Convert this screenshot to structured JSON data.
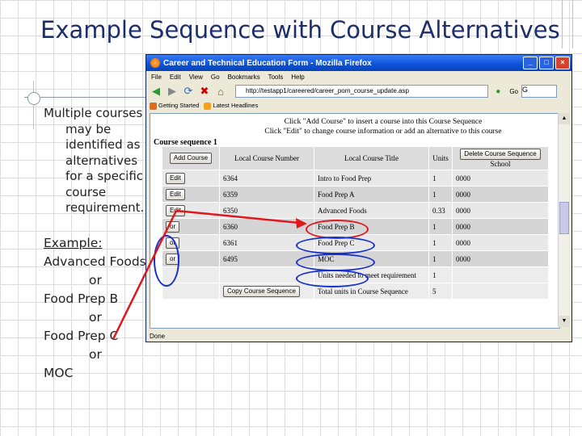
{
  "slide": {
    "title": "Example Sequence with Course Alternatives",
    "bullet_lines": [
      "Multiple courses",
      "may be",
      "identified as",
      "alternatives",
      "for a specific",
      "course",
      "requirement."
    ],
    "example_label": "Example:",
    "example_lines": [
      "Advanced Foods",
      "or",
      "Food Prep B",
      "or",
      "Food Prep C",
      "or",
      "MOC"
    ]
  },
  "browser": {
    "title": "Career and Technical Education Form - Mozilla Firefox",
    "menu": [
      "File",
      "Edit",
      "View",
      "Go",
      "Bookmarks",
      "Tools",
      "Help"
    ],
    "url": "http://testapp1/careered/career_pom_course_update.asp",
    "go_label": "Go",
    "search_label": "G",
    "bookmarks": [
      "Getting Started",
      "Latest Headlines"
    ],
    "status": "Done"
  },
  "page": {
    "instruction_1": "Click \"Add Course\" to insert a course into this Course Sequence",
    "instruction_2": "Click \"Edit\" to change course information or add an alternative to this course",
    "sequence_label": "Course sequence 1",
    "headers": {
      "add_course": "Add Course",
      "local_course_number": "Local Course Number",
      "local_course_title": "Local Course Title",
      "units": "Units",
      "delete_sequence": "Delete Course Sequence",
      "school": "School"
    },
    "rows": [
      {
        "action": "Edit",
        "number": "6364",
        "title": "Intro to Food Prep",
        "units": "1",
        "school": "0000"
      },
      {
        "action": "Edit",
        "number": "6359",
        "title": "Food Prep A",
        "units": "1",
        "school": "0000"
      },
      {
        "action": "Edit",
        "number": "6350",
        "title": "Advanced Foods",
        "units": "0.33",
        "school": "0000"
      },
      {
        "action": "or",
        "number": "6360",
        "title": "Food Prep B",
        "units": "1",
        "school": "0000"
      },
      {
        "action": "or",
        "number": "6361",
        "title": "Food Prep C",
        "units": "1",
        "school": "0000"
      },
      {
        "action": "or",
        "number": "6495",
        "title": "MOC",
        "units": "1",
        "school": "0000"
      }
    ],
    "units_needed_label": "Units needed to meet requirement",
    "units_needed_value": "1",
    "copy_button": "Copy Course Sequence",
    "total_units_label": "Total units in Course Sequence",
    "total_units_value": "5"
  },
  "colors": {
    "title": "#1c2e6b",
    "highlight_red": "#e0181c",
    "highlight_blue": "#1730c9",
    "titlebar": "#0a52d8"
  }
}
